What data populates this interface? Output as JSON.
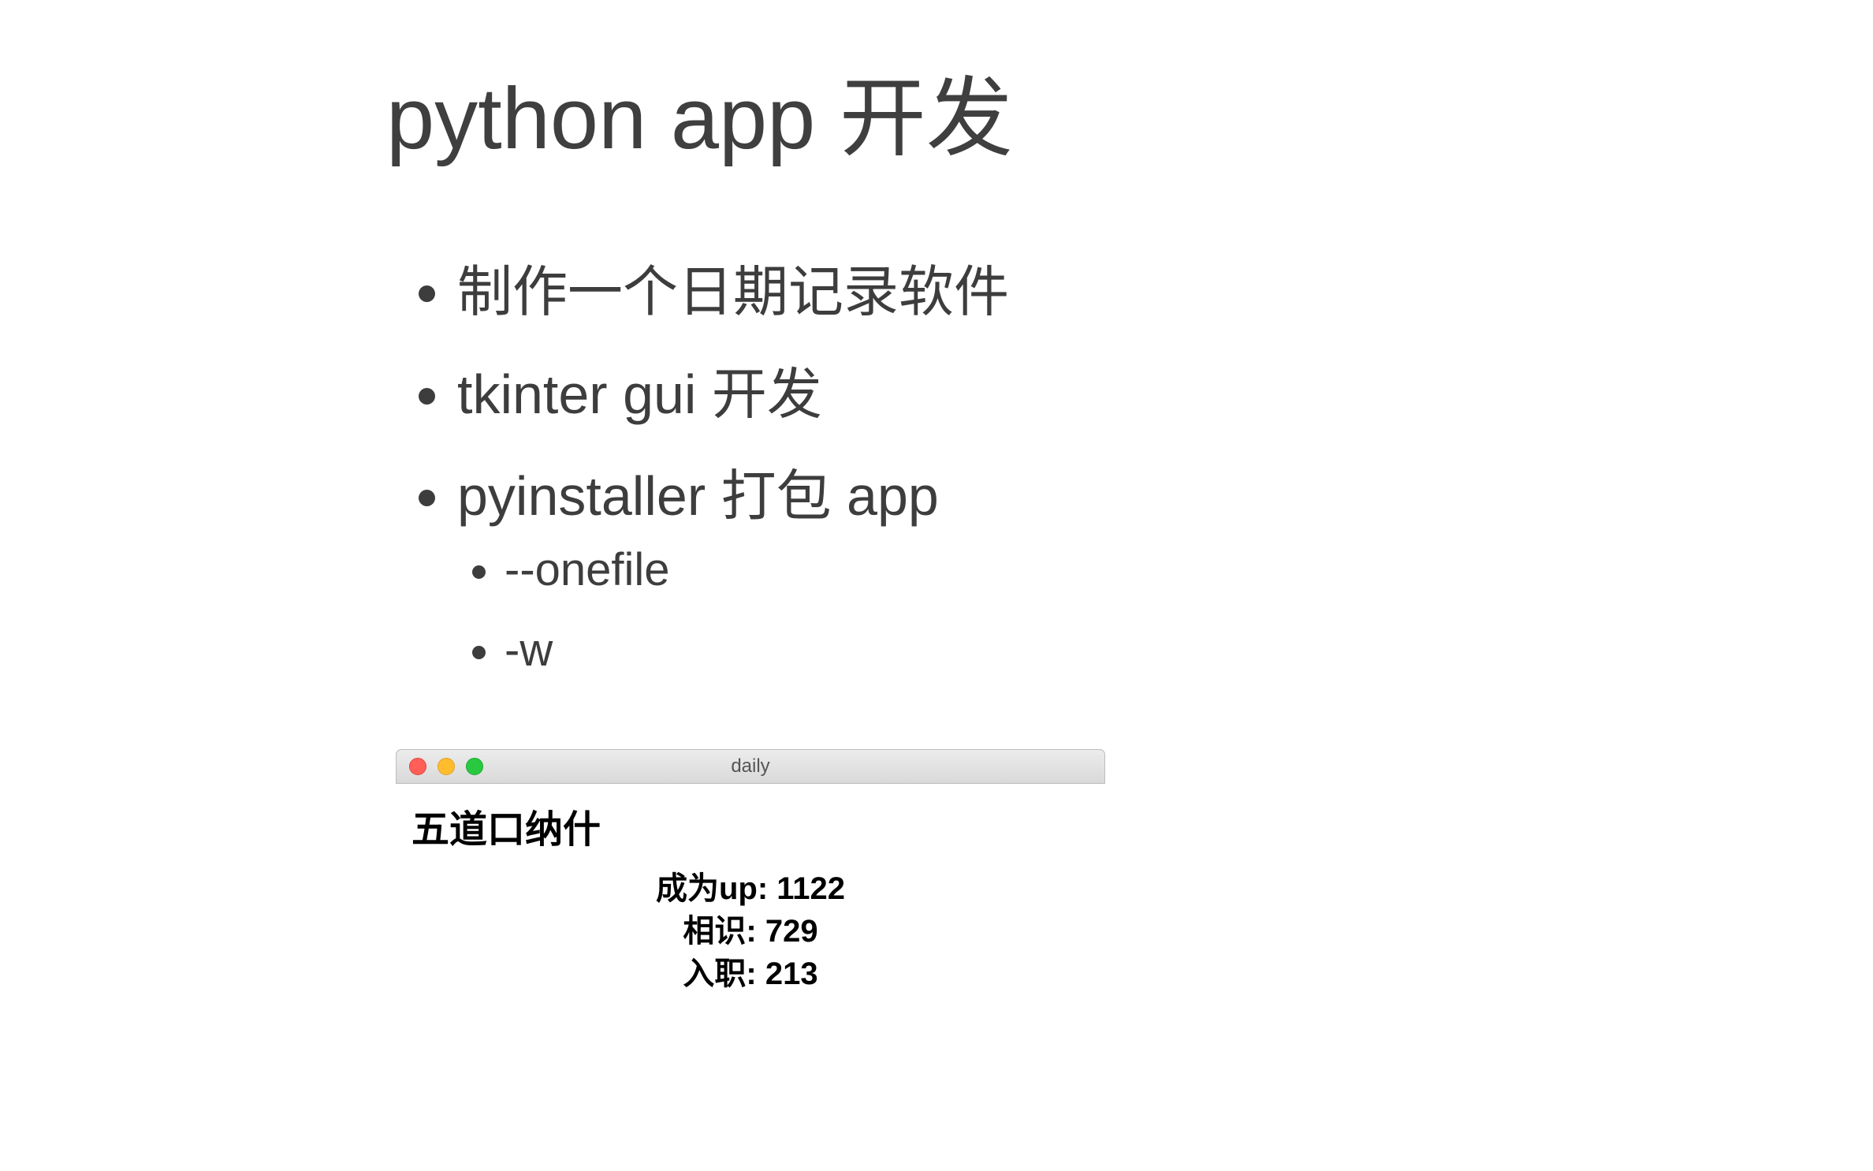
{
  "title": "python app 开发",
  "bullets": {
    "items": [
      "制作一个日期记录软件",
      "tkinter gui 开发",
      "pyinstaller 打包 app"
    ],
    "subitems": [
      "--onefile",
      "-w"
    ]
  },
  "app_window": {
    "title": "daily",
    "heading": "五道口纳什",
    "stats": [
      {
        "label": "成为up",
        "value": "1122"
      },
      {
        "label": "相识",
        "value": "729"
      },
      {
        "label": "入职",
        "value": "213"
      }
    ]
  }
}
